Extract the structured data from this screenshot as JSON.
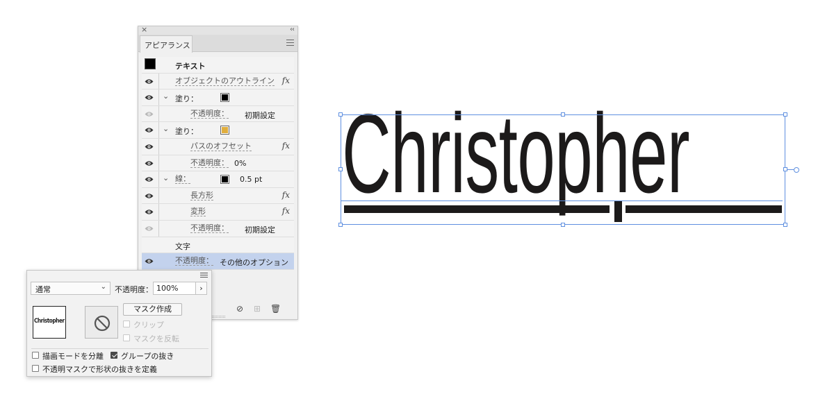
{
  "appearance_panel": {
    "tab_label": "アピアランス",
    "rows": [
      {
        "type": "header",
        "label": "テキスト"
      },
      {
        "type": "effect",
        "label": "オブジェクトのアウトライン",
        "fx": "fx"
      },
      {
        "type": "fill",
        "label": "塗り：",
        "color": "#000000"
      },
      {
        "type": "sub",
        "label": "不透明度：",
        "value": "初期設定"
      },
      {
        "type": "fill",
        "label": "塗り：",
        "color": "#e0ae3e"
      },
      {
        "type": "sub",
        "label": "パスのオフセット",
        "fx": "fx"
      },
      {
        "type": "sub",
        "label": "不透明度：",
        "value": "0%"
      },
      {
        "type": "stroke",
        "label": "線：",
        "color": "#000000",
        "value": "0.5 pt"
      },
      {
        "type": "sub",
        "label": "長方形",
        "fx": "fx"
      },
      {
        "type": "sub",
        "label": "変形",
        "fx": "fx"
      },
      {
        "type": "sub",
        "label": "不透明度：",
        "value": "初期設定"
      },
      {
        "type": "char",
        "label": "文字"
      },
      {
        "type": "opacity",
        "label": "不透明度：",
        "value": "その他のオプション"
      }
    ]
  },
  "transparency_popup": {
    "blend_mode": "通常",
    "opacity_label": "不透明度：",
    "opacity_value": "100%",
    "opacity_arrow": "›",
    "thumbnail_text": "Christopher",
    "make_mask_label": "マスク作成",
    "clip_label": "クリップ",
    "invert_mask_label": "マスクを反転",
    "isolate_blending_label": "描画モードを分離",
    "knockout_group_label": "グループの抜き",
    "opacity_mask_label": "不透明マスクで形状の抜きを定義"
  },
  "artboard": {
    "text": "Christopher",
    "text_color": "#1c1a1a",
    "selection_color": "#5e8fe0"
  }
}
